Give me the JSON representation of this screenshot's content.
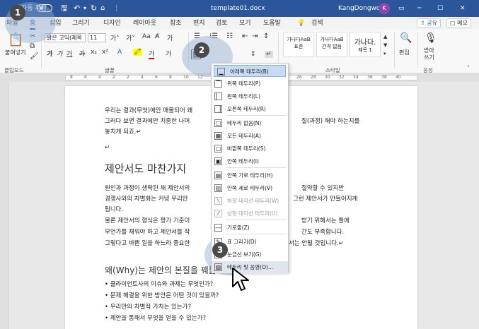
{
  "titlebar": {
    "autosave": "자동 저장",
    "doc_title": "template01.docx",
    "user": "KangDongwoo",
    "avatar": "K",
    "window_controls": [
      "─",
      "☐",
      "✕"
    ]
  },
  "menu_tabs": [
    "파일",
    "홈",
    "삽입",
    "그리기",
    "디자인",
    "레이아웃",
    "참조",
    "편지",
    "검토",
    "보기",
    "도움말"
  ],
  "search_label": "검색",
  "share_label": "공유",
  "memo_label": "메모",
  "ribbon": {
    "paste_label": "붙여넣기",
    "clipboard_group": "클립보드",
    "font_name": "맑은 고딕(제목",
    "font_size": "11",
    "font_group": "글꼴",
    "paragraph_group": "단락",
    "style_tiles": [
      {
        "sample": "가나다AaB",
        "name": "표준"
      },
      {
        "sample": "가나다AaB",
        "name": "간격 없음"
      },
      {
        "sample": "가나다.",
        "name": "제목 1"
      }
    ],
    "styles_group": "스타일",
    "edit_label": "편집",
    "dictate_label": "받아\n쓰기",
    "voice_group": "음성"
  },
  "ruler_numbers": [
    "8",
    "6",
    "4",
    "2",
    "2",
    "4",
    "6",
    "8",
    "10",
    "12",
    "14",
    "16",
    "18",
    "20",
    "22",
    "24",
    "26",
    "28",
    "30",
    "32",
    "34",
    "36",
    "38",
    "40"
  ],
  "document": {
    "lines": [
      "우리는 결과(무엇)에만 매몰되어 왜",
      "그러다 보면 결과에만 치중한 나머",
      "놓치게 되죠.↵",
      "↵",
      "제안서도 마찬가지",
      "원인과 과정이 생략된 채 제안서의",
      "경쟁사와의 차별화는 커녕 우리만",
      "됩니다.",
      "물론 제안서의 형식은 평가 기준이",
      "무언가를 채워야 하고 제안서를 작",
      "그렇다고 바쁜 일을 하느라 중요한",
      "왜(Why)는 제안의 본질을 꿰뚫",
      "• 클라이언트사의 이슈와 과제는 무엇인가?",
      "• 문제 해결을 위한 방안은 어떤 것이 있을까?",
      "• 우리만의 차별적 가치는 있는가?",
      "• 제안을 통해서 무엇을 얻을 수 있는가?"
    ],
    "right_fragments": [
      "질(과정) 해야 하는지를",
      "절약할 수 있지만",
      "그런 제안서가 만들어지게",
      "받기 위해서는 틀에",
      "간도 부족합니다.",
      "서는 안될 것입니다.↵"
    ]
  },
  "border_menu": {
    "items": [
      {
        "label": "아래쪽 테두리(B)",
        "state": "selected"
      },
      {
        "label": "위쪽 테두리(P)",
        "state": "normal"
      },
      {
        "label": "왼쪽 테두리(L)",
        "state": "normal"
      },
      {
        "label": "오른쪽 테두리(R)",
        "state": "normal"
      },
      {
        "label": "테두리 없음(N)",
        "state": "normal"
      },
      {
        "label": "모든 테두리(A)",
        "state": "normal"
      },
      {
        "label": "바깥쪽 테두리(S)",
        "state": "normal"
      },
      {
        "label": "안쪽 테두리(I)",
        "state": "normal"
      },
      {
        "label": "안쪽 가로 테두리(H)",
        "state": "normal"
      },
      {
        "label": "안쪽 세로 테두리(V)",
        "state": "normal"
      },
      {
        "label": "하향 대각선 테두리(W)",
        "state": "dim"
      },
      {
        "label": "상향 대각선 테두리(U)",
        "state": "dim"
      },
      {
        "label": "가로줄(Z)",
        "state": "normal"
      },
      {
        "label": "표 그리기(D)",
        "state": "normal"
      },
      {
        "label": "눈금선 보기(G)",
        "state": "normal"
      },
      {
        "label": "테두리 및 음영(O)...",
        "state": "hover"
      }
    ]
  },
  "steps": [
    "1",
    "2",
    "3"
  ],
  "colors": {
    "titlebar": "#2b579a",
    "accent": "#2b579a",
    "badge": "#4a4a4a",
    "selection": "#c7dcf2"
  }
}
